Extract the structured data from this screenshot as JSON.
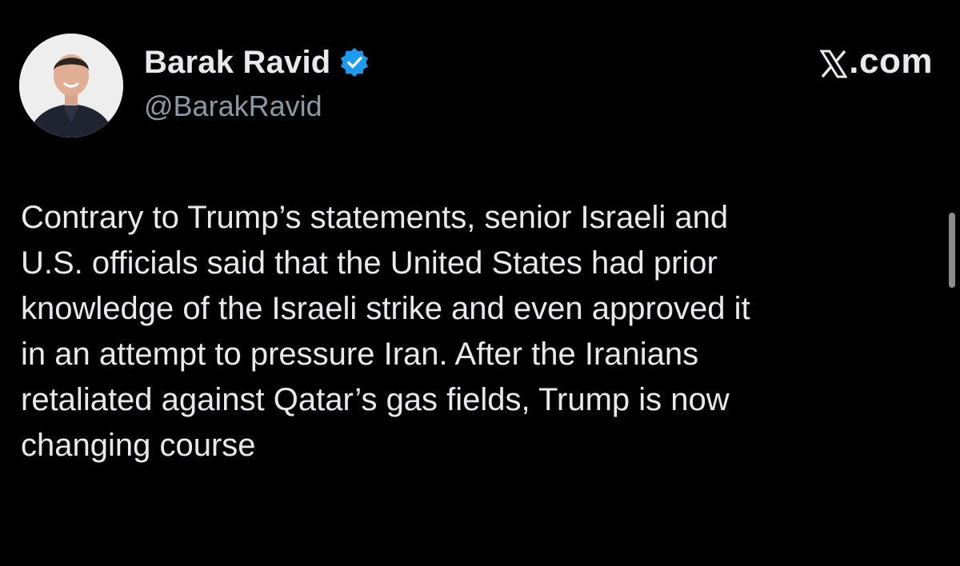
{
  "author": {
    "display_name": "Barak Ravid",
    "handle": "@BarakRavid",
    "verified": true,
    "verified_color": "#1d9bf0",
    "avatar_icon": "person-avatar"
  },
  "source": {
    "label": ".com",
    "logo_icon": "x-logo-icon"
  },
  "tweet": {
    "text": "Contrary to Trump’s statements, senior Israeli and\nU.S. officials said that the United States had prior\nknowledge of the Israeli strike and even approved it\nin an attempt to pressure Iran. After the Iranians\nretaliated against Qatar’s gas fields, Trump is now\nchanging course"
  },
  "colors": {
    "background": "#000000",
    "primary_text": "#e7e9ea",
    "secondary_text": "#8b98a5"
  }
}
